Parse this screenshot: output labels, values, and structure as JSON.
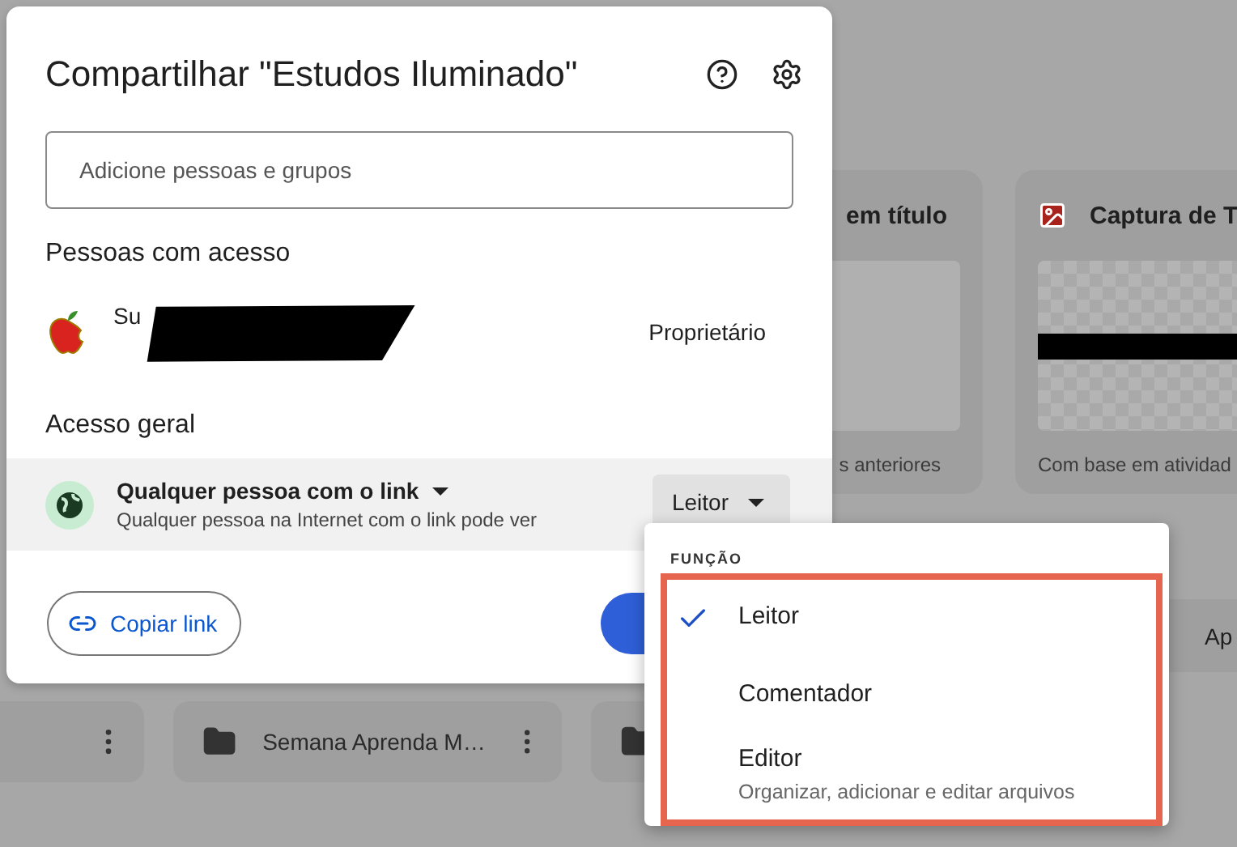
{
  "background": {
    "cards": [
      {
        "kind": "doc",
        "title": "em título",
        "caption": "s anteriores"
      },
      {
        "kind": "image",
        "title": "Captura de T",
        "caption": "Com base em atividad"
      }
    ],
    "middle_card": {
      "title": "Ap"
    },
    "folders": [
      {
        "kind": "menu-only"
      },
      {
        "kind": "folder",
        "name": "Semana Aprenda M…"
      },
      {
        "kind": "icon-only"
      }
    ]
  },
  "dialog": {
    "title": "Compartilhar \"Estudos Iluminado\"",
    "search": {
      "placeholder": "Adicione pessoas e grupos"
    },
    "people_heading": "Pessoas com acesso",
    "people": [
      {
        "name": "Su",
        "role": "Proprietário",
        "redacted": true
      }
    ],
    "general_heading": "Acesso geral",
    "general_access": {
      "scope": "Qualquer pessoa com o link",
      "description": "Qualquer pessoa na Internet com o link pode ver",
      "role": "Leitor"
    },
    "copy_link": "Copiar link"
  },
  "role_menu": {
    "heading": "FUNÇÃO",
    "options": [
      {
        "label": "Leitor",
        "selected": true
      },
      {
        "label": "Comentador",
        "selected": false
      },
      {
        "label": "Editor",
        "description": "Organizar, adicionar e editar arquivos",
        "selected": false
      }
    ]
  }
}
